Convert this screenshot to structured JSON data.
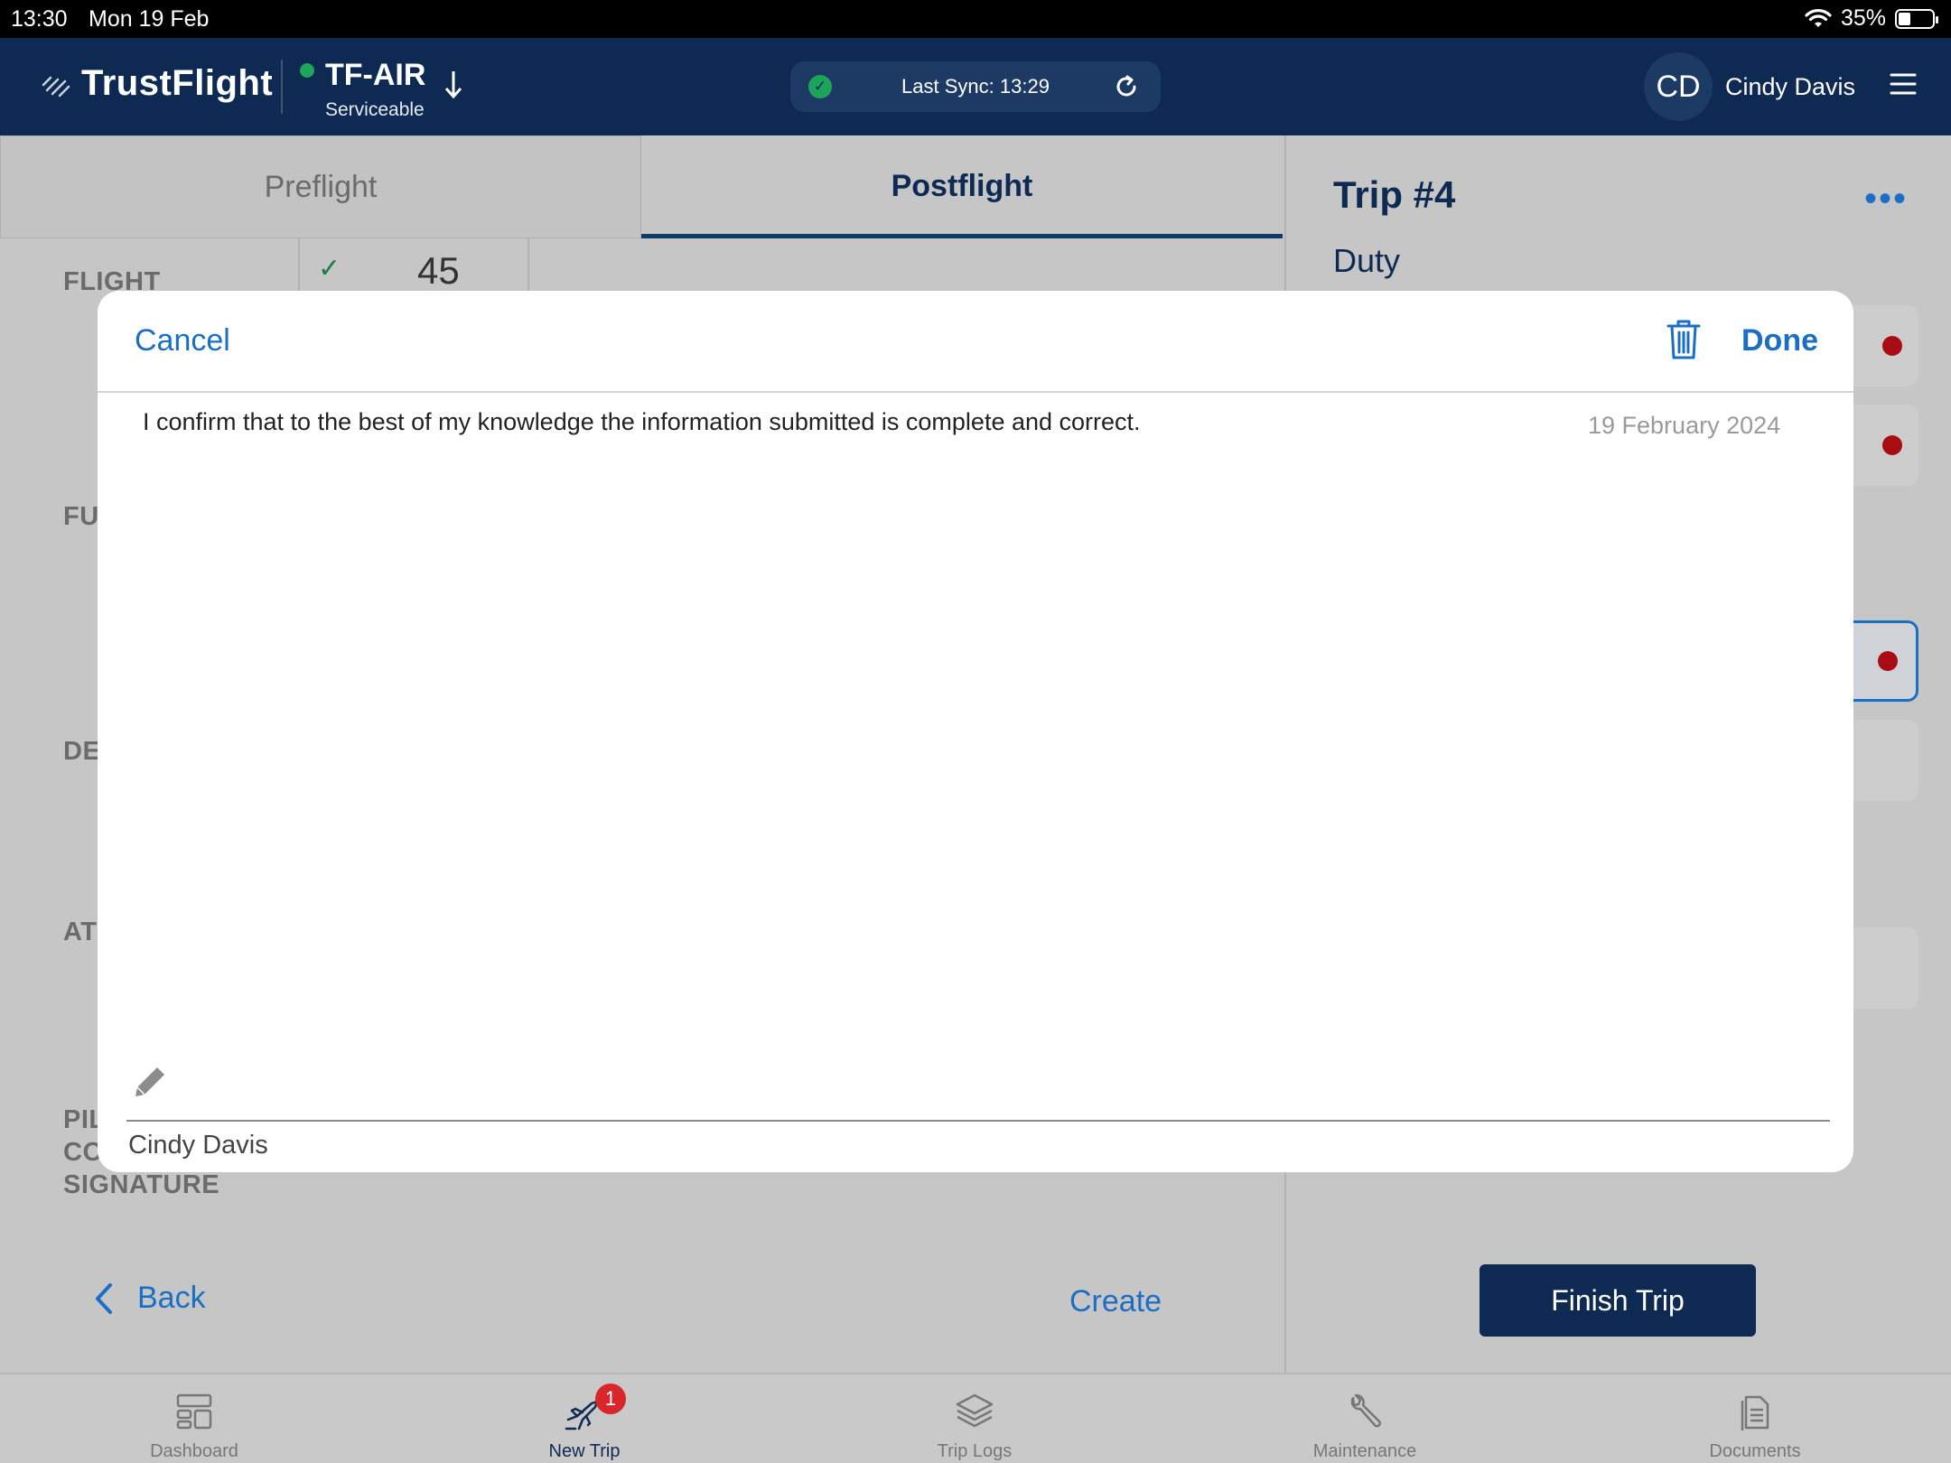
{
  "status_bar": {
    "time": "13:30",
    "date": "Mon 19 Feb",
    "battery": "35%"
  },
  "header": {
    "brand": "TrustFlight",
    "aircraft_registration": "TF-AIR",
    "aircraft_status": "Serviceable",
    "sync_text": "Last Sync: 13:29",
    "user_initials": "CD",
    "user_name": "Cindy Davis"
  },
  "left_panel": {
    "tabs": [
      {
        "label": "Preflight"
      },
      {
        "label": "Postflight"
      }
    ],
    "rows": [
      {
        "label": "FLIGHT"
      },
      {
        "label": "FU"
      },
      {
        "label": "DE"
      },
      {
        "label": "AT"
      }
    ],
    "signature_label_lines": [
      "PIL",
      "CO",
      "SIGNATURE"
    ],
    "flight_value": "45",
    "back_label": "Back",
    "create_label": "Create"
  },
  "right_panel": {
    "trip_title": "Trip #4",
    "more_label": "•••",
    "section": "Duty",
    "finish_label": "Finish Trip"
  },
  "modal": {
    "cancel_label": "Cancel",
    "done_label": "Done",
    "statement": "I confirm that to the best of my knowledge the information submitted is complete and correct.",
    "date": "19 February 2024",
    "signer_name": "Cindy Davis"
  },
  "tab_bar": {
    "items": [
      {
        "label": "Dashboard",
        "icon": "dashboard-icon"
      },
      {
        "label": "New Trip",
        "icon": "plane-takeoff-icon",
        "badge": "1"
      },
      {
        "label": "Trip Logs",
        "icon": "layers-icon"
      },
      {
        "label": "Maintenance",
        "icon": "wrench-icon"
      },
      {
        "label": "Documents",
        "icon": "documents-icon"
      }
    ]
  },
  "colors": {
    "header_bg": "#0e2a52",
    "accent_blue": "#1a6fc5",
    "status_green": "#1ea35a",
    "alert_red": "#a80d14",
    "badge_red": "#d8262b"
  }
}
